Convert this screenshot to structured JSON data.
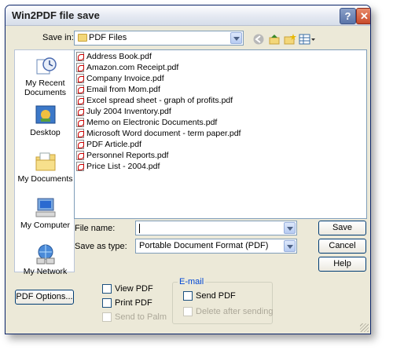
{
  "window": {
    "title": "Win2PDF file save"
  },
  "toolbar": {
    "save_in_label": "Save in:",
    "save_in_value": "PDF Files"
  },
  "sidebar": {
    "items": [
      {
        "label1": "My Recent",
        "label2": "Documents"
      },
      {
        "label1": "Desktop",
        "label2": ""
      },
      {
        "label1": "My Documents",
        "label2": ""
      },
      {
        "label1": "My Computer",
        "label2": ""
      },
      {
        "label1": "My Network",
        "label2": ""
      }
    ]
  },
  "files": [
    "Address Book.pdf",
    "Amazon.com Receipt.pdf",
    "Company Invoice.pdf",
    "Email from Mom.pdf",
    "Excel spread sheet - graph of profits.pdf",
    "July 2004 Inventory.pdf",
    "Memo on Electronic Documents.pdf",
    "Microsoft Word document - term paper.pdf",
    "PDF Article.pdf",
    "Personnel Reports.pdf",
    "Price List - 2004.pdf"
  ],
  "form": {
    "file_name_label": "File name:",
    "file_name_value": "",
    "save_type_label": "Save as type:",
    "save_type_value": "Portable Document Format (PDF)"
  },
  "buttons": {
    "save": "Save",
    "cancel": "Cancel",
    "help": "Help",
    "pdf_options": "PDF Options..."
  },
  "options": {
    "view_pdf": "View PDF",
    "print_pdf": "Print PDF",
    "send_to_palm": "Send to Palm"
  },
  "email": {
    "group_label": "E-mail",
    "send_pdf": "Send PDF",
    "delete_after": "Delete after sending"
  },
  "colors": {
    "window_bg": "#ece9d8",
    "accent": "#0046d5",
    "button_border": "#003c74"
  }
}
